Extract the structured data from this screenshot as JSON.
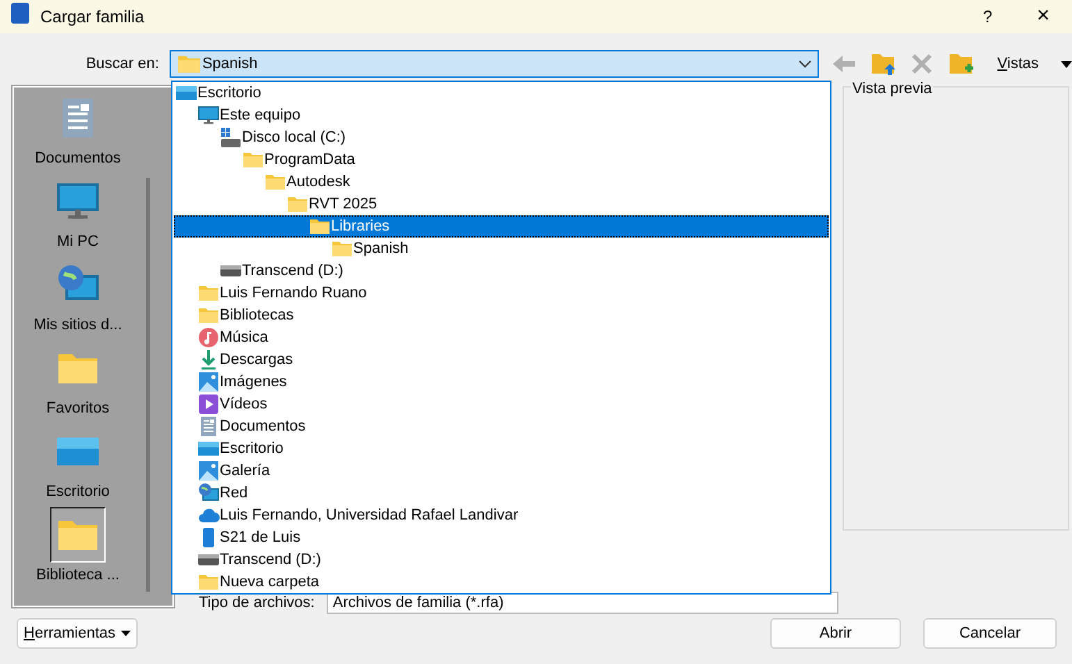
{
  "window": {
    "title": "Cargar familia",
    "help": "?",
    "close": "×"
  },
  "look_in": {
    "label": "Buscar en:",
    "value": "Spanish",
    "kind": "folder"
  },
  "toolbar": {
    "views": "Vistas"
  },
  "sidebar": {
    "items": [
      {
        "label": "Documentos",
        "kind": "documents",
        "selected": false
      },
      {
        "label": "Mi PC",
        "kind": "computer",
        "selected": false
      },
      {
        "label": "Mis sitios d...",
        "kind": "network",
        "selected": false
      },
      {
        "label": "Favoritos",
        "kind": "folder",
        "selected": false
      },
      {
        "label": "Escritorio",
        "kind": "desktop",
        "selected": false
      },
      {
        "label": "Biblioteca ...",
        "kind": "folder",
        "selected": true
      }
    ]
  },
  "preview": {
    "title": "Vista previa"
  },
  "file_type": {
    "label": "Tipo de archivos:",
    "value": "Archivos de familia (*.rfa)"
  },
  "location_dropdown": {
    "items": [
      {
        "label": "Escritorio",
        "kind": "desktop",
        "selected": false,
        "children": [
          {
            "label": "Este equipo",
            "kind": "computer",
            "selected": false,
            "children": [
              {
                "label": "Disco local (C:)",
                "kind": "drive",
                "selected": false,
                "children": [
                  {
                    "label": "ProgramData",
                    "kind": "folder",
                    "selected": false,
                    "children": [
                      {
                        "label": "Autodesk",
                        "kind": "folder",
                        "selected": false,
                        "children": [
                          {
                            "label": "RVT 2025",
                            "kind": "folder",
                            "selected": false,
                            "children": [
                              {
                                "label": "Libraries",
                                "kind": "folder",
                                "selected": true,
                                "children": [
                                  {
                                    "label": "Spanish",
                                    "kind": "folder",
                                    "selected": false
                                  }
                                ]
                              }
                            ]
                          }
                        ]
                      }
                    ]
                  }
                ]
              },
              {
                "label": "Transcend (D:)",
                "kind": "usb",
                "selected": false
              }
            ]
          },
          {
            "label": "Luis Fernando Ruano",
            "kind": "folder",
            "selected": false
          },
          {
            "label": "Bibliotecas",
            "kind": "folder",
            "selected": false
          },
          {
            "label": "Música",
            "kind": "music",
            "selected": false
          },
          {
            "label": "Descargas",
            "kind": "download",
            "selected": false
          },
          {
            "label": "Imágenes",
            "kind": "images",
            "selected": false
          },
          {
            "label": "Vídeos",
            "kind": "videos",
            "selected": false
          },
          {
            "label": "Documentos",
            "kind": "documents",
            "selected": false
          },
          {
            "label": "Escritorio",
            "kind": "desktop",
            "selected": false
          },
          {
            "label": "Galería",
            "kind": "images",
            "selected": false
          },
          {
            "label": "Red",
            "kind": "network",
            "selected": false
          },
          {
            "label": "Luis Fernando, Universidad Rafael Landivar",
            "kind": "cloud",
            "selected": false
          },
          {
            "label": "S21 de Luis",
            "kind": "phone",
            "selected": false
          },
          {
            "label": "Transcend (D:)",
            "kind": "usb",
            "selected": false
          },
          {
            "label": "Nueva carpeta",
            "kind": "folder",
            "selected": false
          }
        ]
      }
    ]
  },
  "buttons": {
    "tools": "Herramientas",
    "open": "Abrir",
    "cancel": "Cancelar"
  }
}
